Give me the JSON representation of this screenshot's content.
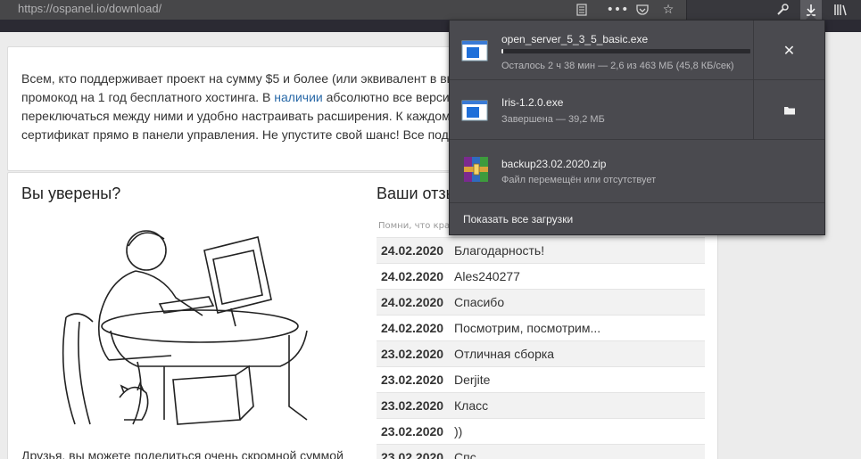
{
  "browser": {
    "url": "https://ospanel.io/download/",
    "icons": [
      "reader-view-icon",
      "more-icon",
      "pocket-icon",
      "bookmark-star-icon",
      "wrench-icon",
      "download-icon",
      "library-icon"
    ]
  },
  "page": {
    "promo_lines": [
      "Всем, кто поддерживает проект на сумму $5 и более (или эквивалент в вы",
      "промокод на 1 год бесплатного хостинга. В ",
      "переключаться между ними и удобно настраивать расширения. К каждом",
      "сертификат прямо в панели управления. Не упустите свой шанс! Все подр"
    ],
    "promo_link": "наличии",
    "promo_line2_rest": " абсолютно все версии",
    "left_heading": "Вы уверены?",
    "right_heading": "Ваши отзы",
    "hint": "Помни, что кра",
    "bottom_text": "Друзья, вы можете поделиться очень скромной суммой",
    "reviews": [
      {
        "date": "24.02.2020",
        "text": "Благодарность!"
      },
      {
        "date": "24.02.2020",
        "text": "Ales240277"
      },
      {
        "date": "24.02.2020",
        "text": "Спасибо"
      },
      {
        "date": "24.02.2020",
        "text": "Посмотрим, посмотрим..."
      },
      {
        "date": "23.02.2020",
        "text": "Отличная сборка"
      },
      {
        "date": "23.02.2020",
        "text": "Derjite"
      },
      {
        "date": "23.02.2020",
        "text": "Класс"
      },
      {
        "date": "23.02.2020",
        "text": "))"
      },
      {
        "date": "23.02.2020",
        "text": "Спс"
      }
    ]
  },
  "downloads": {
    "items": [
      {
        "name": "open_server_5_3_5_basic.exe",
        "status": "Осталось 2 ч 38 мин — 2,6 из 463 МБ (45,8 КБ/сек)",
        "progress": 0.006,
        "action": "cancel-icon",
        "icon": "exe-file-icon"
      },
      {
        "name": "Iris-1.2.0.exe",
        "status": "Завершена — 39,2 МБ",
        "action": "folder-icon",
        "icon": "exe-file-icon"
      },
      {
        "name": "backup23.02.2020.zip",
        "status": "Файл перемещён или отсутствует",
        "icon": "archive-file-icon"
      }
    ],
    "show_all": "Показать все загрузки"
  },
  "colors": {
    "toolbar": "#38383d",
    "panel": "#4a4a4f",
    "link": "#2a6aa8"
  }
}
